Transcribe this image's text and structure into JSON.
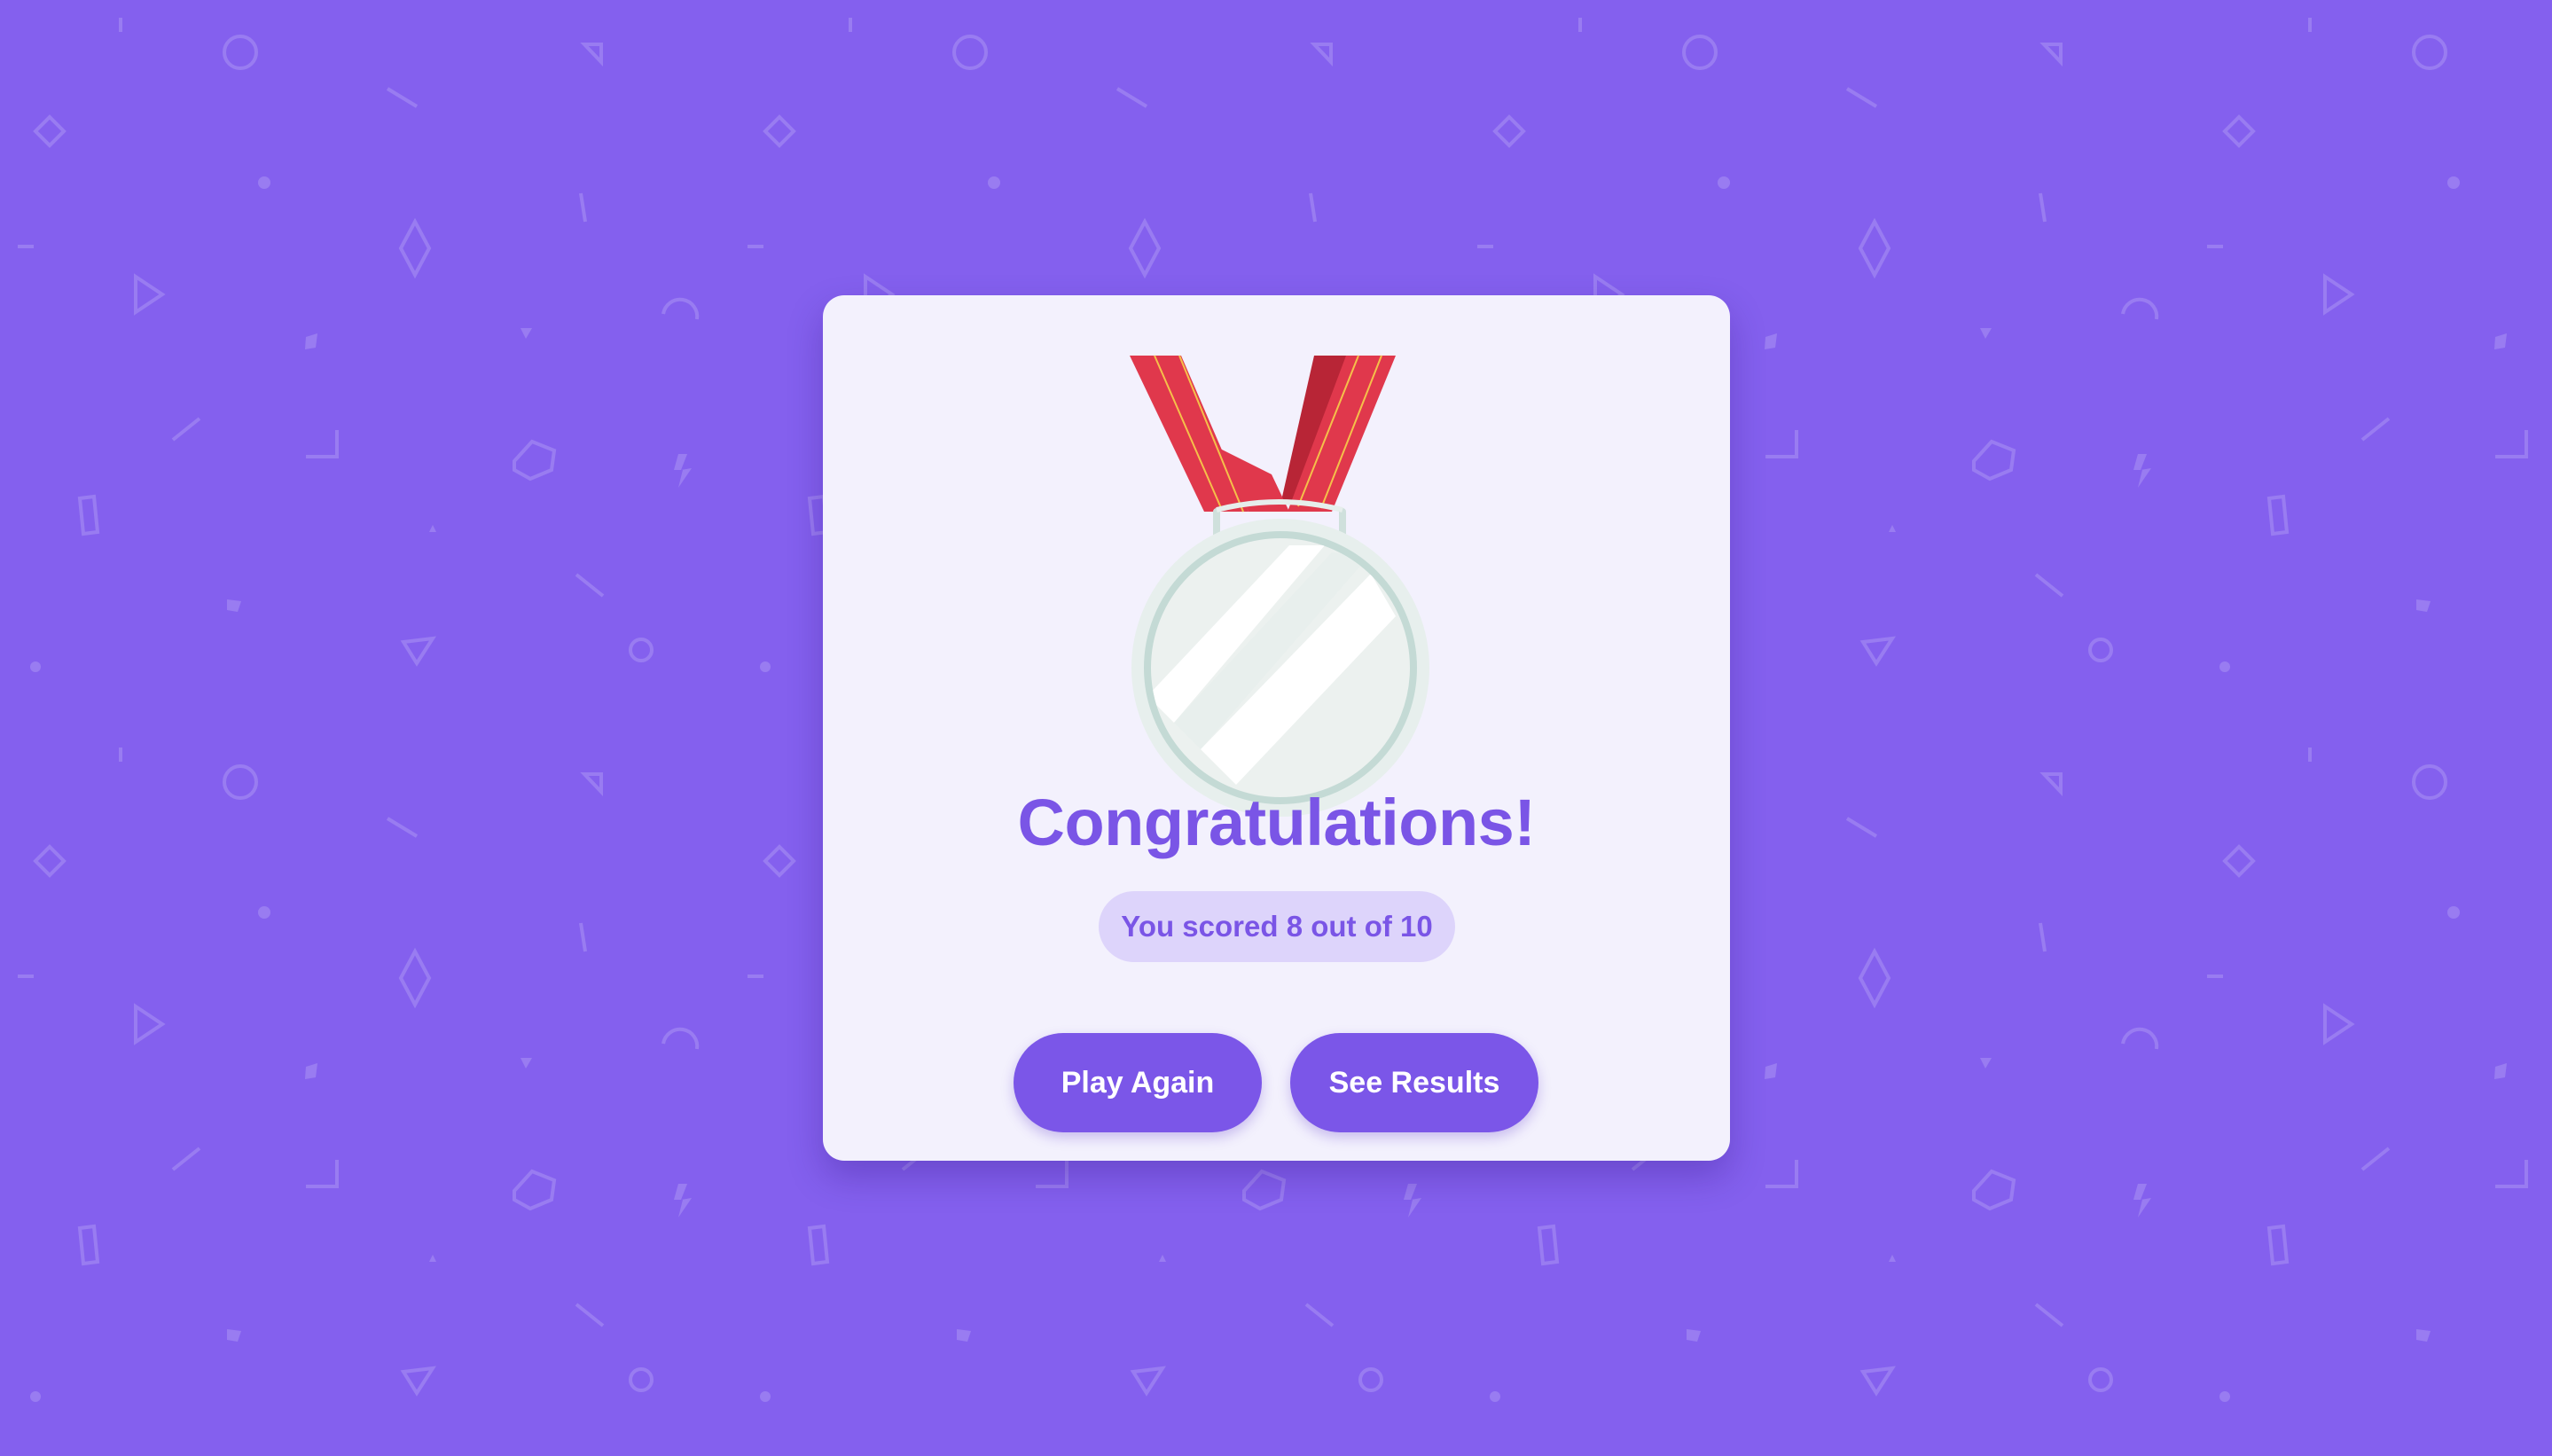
{
  "theme": {
    "background": "#8460ee",
    "card_background": "#f3f1fd",
    "accent": "#7a55e6",
    "score_pill_background": "#ddd4fb",
    "ribbon_red": "#e0384c",
    "medal_silver": "#ecf1ef"
  },
  "result": {
    "title": "Congratulations!",
    "score_text": "You scored 8 out of 10",
    "medal_icon": "silver-medal-icon"
  },
  "actions": {
    "play_again_label": "Play Again",
    "see_results_label": "See Results"
  }
}
